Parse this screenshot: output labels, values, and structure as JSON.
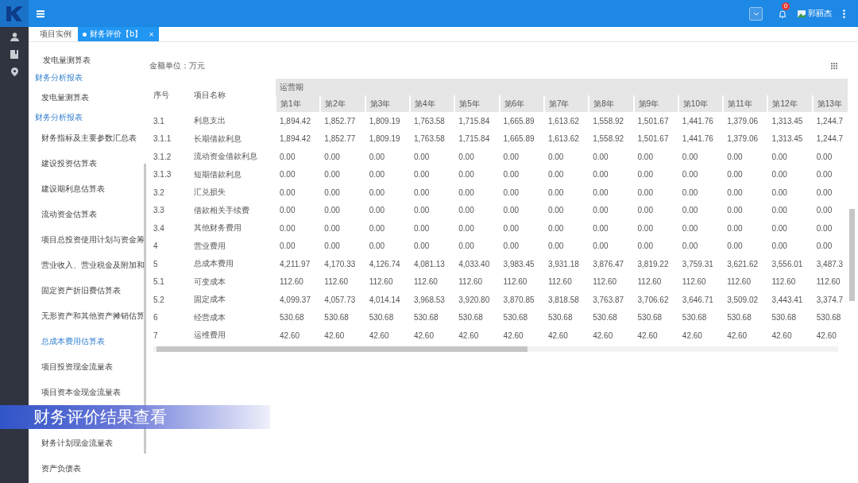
{
  "top_bar": {
    "notification_count": "0",
    "user_name": "郭丽杰"
  },
  "tabs": [
    {
      "label": "项目实例",
      "selected": false,
      "closable": false
    },
    {
      "label": "财务评价【b】",
      "selected": true,
      "closable": true,
      "close": "×"
    }
  ],
  "sidebar": {
    "items": [
      {
        "kind": "item",
        "label": "发电量测算表",
        "selected": false
      },
      {
        "kind": "header",
        "label": "财务分析报表"
      },
      {
        "kind": "item",
        "label": "发电量测算表",
        "selected": false
      },
      {
        "kind": "header",
        "label": "财务分析报表"
      },
      {
        "kind": "item",
        "label": "财务指标及主要参数汇总表",
        "selected": false
      },
      {
        "kind": "item",
        "label": "建设投资估算表",
        "selected": false
      },
      {
        "kind": "item",
        "label": "建设期利息估算表",
        "selected": false
      },
      {
        "kind": "item",
        "label": "流动资金估算表",
        "selected": false
      },
      {
        "kind": "item",
        "label": "项目总投资使用计划与资金筹",
        "selected": false
      },
      {
        "kind": "item",
        "label": "营业收入、营业税金及附加和",
        "selected": false
      },
      {
        "kind": "item",
        "label": "固定资产折旧费估算表",
        "selected": false
      },
      {
        "kind": "item",
        "label": "无形资产和其他资产摊销估算",
        "selected": false
      },
      {
        "kind": "item",
        "label": "总成本费用估算表",
        "selected": true
      },
      {
        "kind": "item",
        "label": "项目投资现金流量表",
        "selected": false
      },
      {
        "kind": "item",
        "label": "项目资本金现金流量表",
        "selected": false
      },
      {
        "kind": "covered"
      },
      {
        "kind": "item",
        "label": "财务计划现金流量表",
        "selected": false
      },
      {
        "kind": "item",
        "label": "资产负债表",
        "selected": false
      }
    ]
  },
  "caption": "财务评价结果查看",
  "table": {
    "unit": "金额单位：万元",
    "columns": [
      "序号",
      "项目名称"
    ],
    "group": "运营期",
    "years": [
      "第1年",
      "第2年",
      "第3年",
      "第4年",
      "第5年",
      "第6年",
      "第7年",
      "第8年",
      "第9年",
      "第10年",
      "第11年",
      "第12年",
      "第13年"
    ],
    "rows": [
      {
        "seq": "3.1",
        "name": "利息支出",
        "values": [
          "1,894.42",
          "1,852.77",
          "1,809.19",
          "1,763.58",
          "1,715.84",
          "1,665.89",
          "1,613.62",
          "1,558.92",
          "1,501.67",
          "1,441.76",
          "1,379.06",
          "1,313.45",
          "1,244.7"
        ]
      },
      {
        "seq": "3.1.1",
        "name": "长期借款利息",
        "values": [
          "1,894.42",
          "1,852.77",
          "1,809.19",
          "1,763.58",
          "1,715.84",
          "1,665.89",
          "1,613.62",
          "1,558.92",
          "1,501.67",
          "1,441.76",
          "1,379.06",
          "1,313.45",
          "1,244.7"
        ]
      },
      {
        "seq": "3.1.2",
        "name": "流动资金借款利息",
        "values": [
          "0.00",
          "0.00",
          "0.00",
          "0.00",
          "0.00",
          "0.00",
          "0.00",
          "0.00",
          "0.00",
          "0.00",
          "0.00",
          "0.00",
          "0.00"
        ]
      },
      {
        "seq": "3.1.3",
        "name": "短期借款利息",
        "values": [
          "0.00",
          "0.00",
          "0.00",
          "0.00",
          "0.00",
          "0.00",
          "0.00",
          "0.00",
          "0.00",
          "0.00",
          "0.00",
          "0.00",
          "0.00"
        ]
      },
      {
        "seq": "3.2",
        "name": "汇兑损失",
        "values": [
          "0.00",
          "0.00",
          "0.00",
          "0.00",
          "0.00",
          "0.00",
          "0.00",
          "0.00",
          "0.00",
          "0.00",
          "0.00",
          "0.00",
          "0.00"
        ]
      },
      {
        "seq": "3.3",
        "name": "借款相关手续费",
        "values": [
          "0.00",
          "0.00",
          "0.00",
          "0.00",
          "0.00",
          "0.00",
          "0.00",
          "0.00",
          "0.00",
          "0.00",
          "0.00",
          "0.00",
          "0.00"
        ]
      },
      {
        "seq": "3.4",
        "name": "其他财务费用",
        "values": [
          "0.00",
          "0.00",
          "0.00",
          "0.00",
          "0.00",
          "0.00",
          "0.00",
          "0.00",
          "0.00",
          "0.00",
          "0.00",
          "0.00",
          "0.00"
        ]
      },
      {
        "seq": "4",
        "name": "营业费用",
        "values": [
          "0.00",
          "0.00",
          "0.00",
          "0.00",
          "0.00",
          "0.00",
          "0.00",
          "0.00",
          "0.00",
          "0.00",
          "0.00",
          "0.00",
          "0.00"
        ]
      },
      {
        "seq": "5",
        "name": "总成本费用",
        "values": [
          "4,211.97",
          "4,170.33",
          "4,126.74",
          "4,081.13",
          "4,033.40",
          "3,983.45",
          "3,931.18",
          "3,876.47",
          "3,819.22",
          "3,759.31",
          "3,621.62",
          "3,556.01",
          "3,487.3"
        ]
      },
      {
        "seq": "5.1",
        "name": "可变成本",
        "values": [
          "112.60",
          "112.60",
          "112.60",
          "112.60",
          "112.60",
          "112.60",
          "112.60",
          "112.60",
          "112.60",
          "112.60",
          "112.60",
          "112.60",
          "112.60"
        ]
      },
      {
        "seq": "5.2",
        "name": "固定成本",
        "values": [
          "4,099.37",
          "4,057.73",
          "4,014.14",
          "3,968.53",
          "3,920.80",
          "3,870.85",
          "3,818.58",
          "3,763.87",
          "3,706.62",
          "3,646.71",
          "3,509.02",
          "3,443.41",
          "3,374.7"
        ]
      },
      {
        "seq": "6",
        "name": "经营成本",
        "values": [
          "530.68",
          "530.68",
          "530.68",
          "530.68",
          "530.68",
          "530.68",
          "530.68",
          "530.68",
          "530.68",
          "530.68",
          "530.68",
          "530.68",
          "530.68"
        ]
      },
      {
        "seq": "7",
        "name": "运维费用",
        "values": [
          "42.60",
          "42.60",
          "42.60",
          "42.60",
          "42.60",
          "42.60",
          "42.60",
          "42.60",
          "42.60",
          "42.60",
          "42.60",
          "42.60",
          "42.60"
        ]
      }
    ]
  }
}
